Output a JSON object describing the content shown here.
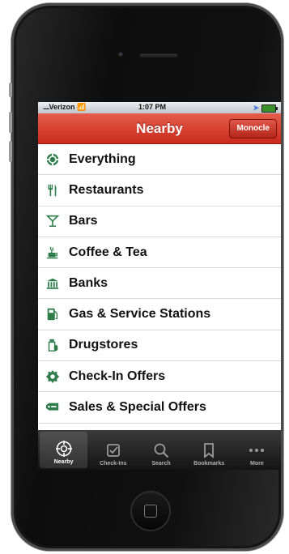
{
  "status_bar": {
    "carrier": "Verizon",
    "time": "1:07 PM"
  },
  "nav": {
    "title": "Nearby",
    "right_button": "Monocle"
  },
  "list": [
    {
      "label": "Everything",
      "icon": "crosshair-icon"
    },
    {
      "label": "Restaurants",
      "icon": "fork-knife-icon"
    },
    {
      "label": "Bars",
      "icon": "cocktail-glass-icon"
    },
    {
      "label": "Coffee & Tea",
      "icon": "coffee-cup-icon"
    },
    {
      "label": "Banks",
      "icon": "bank-icon"
    },
    {
      "label": "Gas & Service Stations",
      "icon": "gas-pump-icon"
    },
    {
      "label": "Drugstores",
      "icon": "pill-bottle-icon"
    },
    {
      "label": "Check-In Offers",
      "icon": "badge-icon"
    },
    {
      "label": "Sales & Special Offers",
      "icon": "tag-icon"
    }
  ],
  "tabs": [
    {
      "label": "Nearby",
      "icon": "crosshair-icon",
      "active": true
    },
    {
      "label": "Check-Ins",
      "icon": "checkbox-icon"
    },
    {
      "label": "Search",
      "icon": "magnifier-icon"
    },
    {
      "label": "Bookmarks",
      "icon": "bookmark-icon"
    },
    {
      "label": "More",
      "icon": "more-dots-icon"
    }
  ],
  "colors": {
    "nav_red": "#d43a2a",
    "icon_green": "#2f7d4a",
    "tabbar_dark": "#1e1e1e"
  }
}
